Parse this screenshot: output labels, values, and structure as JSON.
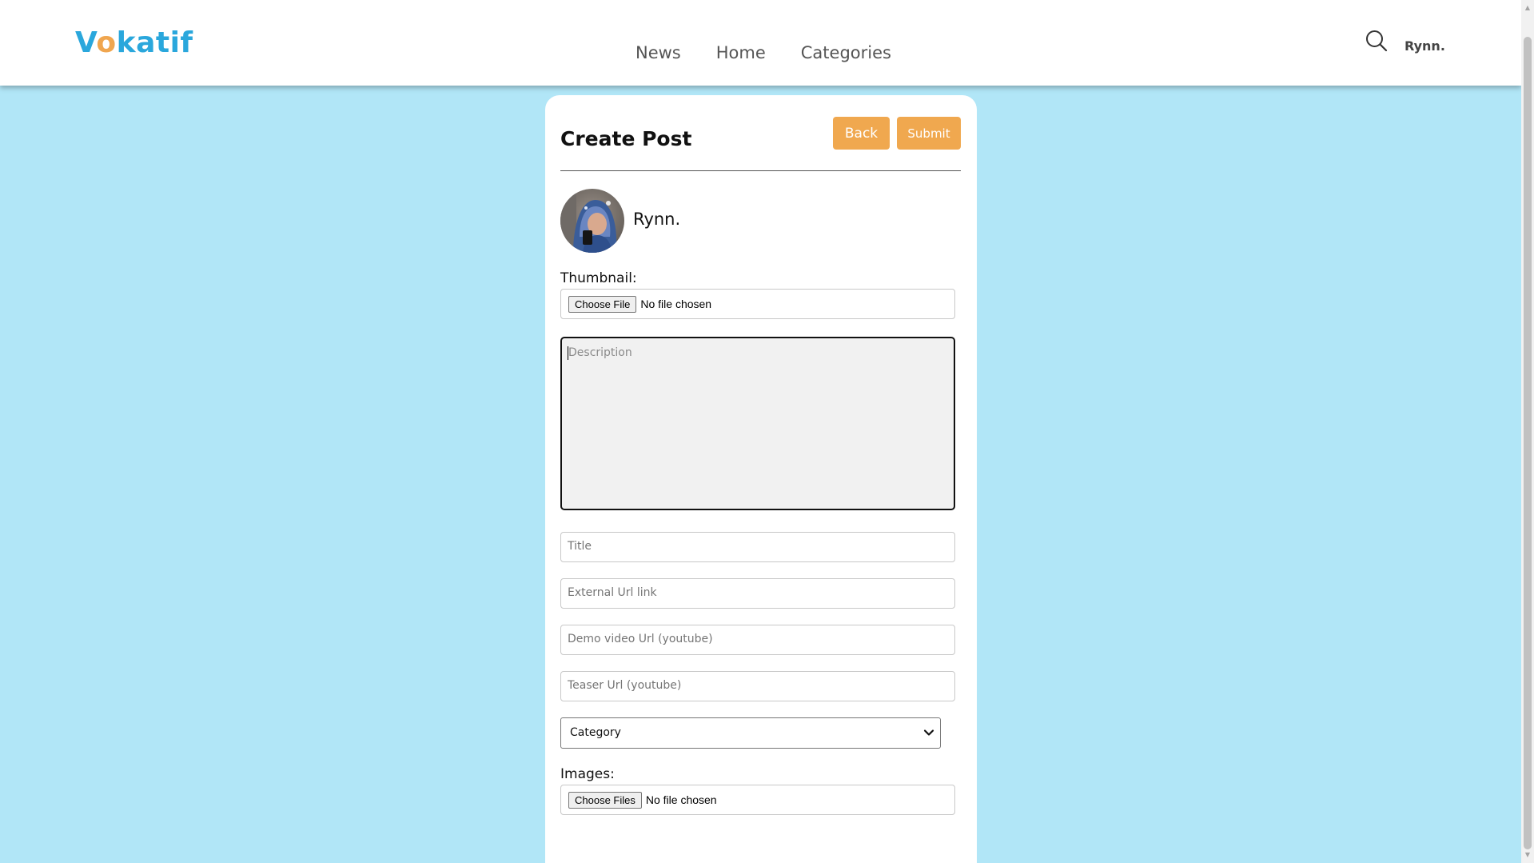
{
  "header": {
    "logo_prefix": "V",
    "logo_accent": "o",
    "logo_suffix": "katif",
    "nav": [
      "News",
      "Home",
      "Categories"
    ],
    "user_name": "Rynn."
  },
  "form": {
    "title": "Create Post",
    "back_label": "Back",
    "submit_label": "Submit",
    "author_name": "Rynn.",
    "thumbnail_label": "Thumbnail:",
    "thumbnail_button": "Choose File",
    "thumbnail_status": "No file chosen",
    "description_placeholder": "Description",
    "title_placeholder": "Title",
    "external_url_placeholder": "External Url link",
    "demo_video_placeholder": "Demo video Url (youtube)",
    "teaser_placeholder": "Teaser Url (youtube)",
    "category_value": "Category",
    "images_label": "Images:",
    "images_button": "Choose Files",
    "images_status": "No file chosen"
  },
  "colors": {
    "background": "#b1e6f7",
    "accent": "#f0a84f",
    "logo_blue": "#2aa7dc",
    "logo_orange": "#f0a64f"
  },
  "icons": {
    "search": "search-icon",
    "select_chevron": "chevron-down-icon"
  }
}
